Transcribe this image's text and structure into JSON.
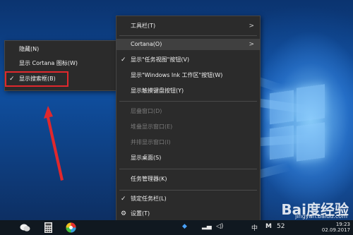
{
  "left_menu": {
    "items": [
      {
        "label": "隐藏(N)",
        "checked": false
      },
      {
        "label": "显示 Cortana 图标(W)",
        "checked": false
      },
      {
        "label": "显示搜索框(B)",
        "checked": true
      }
    ]
  },
  "main_menu": {
    "items": [
      {
        "label": "工具栏(T)",
        "submenu": true
      },
      {
        "label": "Cortana(O)",
        "submenu": true,
        "highlighted": true
      },
      {
        "label": "显示\"任务视图\"按钮(V)",
        "checked": true
      },
      {
        "label": "显示\"Windows Ink 工作区\"按钮(W)"
      },
      {
        "label": "显示触摸键盘按钮(Y)"
      },
      {
        "label": "层叠窗口(D)",
        "disabled": true
      },
      {
        "label": "堆叠显示窗口(E)",
        "disabled": true
      },
      {
        "label": "并排显示窗口(I)",
        "disabled": true
      },
      {
        "label": "显示桌面(S)"
      },
      {
        "label": "任务管理器(K)"
      },
      {
        "label": "锁定任务栏(L)",
        "checked": true
      },
      {
        "label": "设置(T)",
        "icon": "gear-icon"
      }
    ]
  },
  "taskbar": {
    "tray_text": "中",
    "tray_num": "52",
    "clock_time": "19:23",
    "clock_date": "02.09.2017"
  },
  "watermark": {
    "text": "Bai度经验",
    "sub": "jingyan.baidu.com"
  },
  "colors": {
    "menu_bg": "#2b2b2b",
    "highlight": "#404040",
    "annotation_red": "#e0282d"
  }
}
